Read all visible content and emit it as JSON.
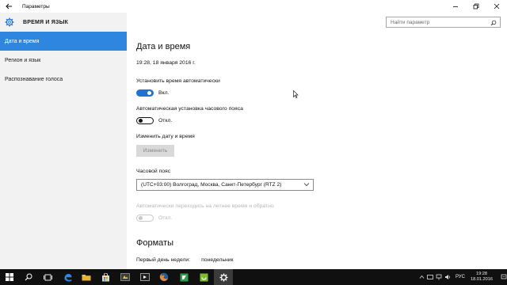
{
  "window": {
    "title": "Параметры",
    "controls": [
      "minimize",
      "maximize",
      "close"
    ]
  },
  "sidebar": {
    "title": "ВРЕМЯ И ЯЗЫК",
    "items": [
      {
        "label": "Дата и время",
        "active": true
      },
      {
        "label": "Регион и язык",
        "active": false
      },
      {
        "label": "Распознавание голоса",
        "active": false
      }
    ]
  },
  "search": {
    "placeholder": "Найти параметр"
  },
  "main": {
    "heading": "Дата и время",
    "current_datetime": "19:28, 18 января 2016 г.",
    "auto_time": {
      "label": "Установить время автоматически",
      "state": "Вкл.",
      "on": true
    },
    "auto_timezone": {
      "label": "Автоматическая установка часового пояса",
      "state": "Откл.",
      "on": false
    },
    "change_datetime": {
      "label": "Изменить дату и время",
      "button": "Изменить"
    },
    "timezone": {
      "label": "Часовой пояс",
      "value": "(UTC+03:00) Волгоград, Москва, Санкт-Петербург (RTZ 2)"
    },
    "dst": {
      "label": "Автоматически переходить на летнее время и обратно",
      "state": "Откл.",
      "enabled": false
    },
    "formats": {
      "heading": "Форматы",
      "first_day_label": "Первый день недели:",
      "first_day_value": "понедельник"
    }
  },
  "taskbar": {
    "items": [
      "start-icon",
      "search-icon",
      "task-view-icon",
      "edge-icon",
      "explorer-icon",
      "store-icon",
      "app-icon",
      "media-icon",
      "firefox-icon",
      "green-app-icon",
      "settings-app-icon",
      "gear-icon"
    ],
    "language": "РУС",
    "time": "19:28",
    "date": "18.01.2016"
  },
  "colors": {
    "accent": "#2e86de",
    "toggle_on": "#1e73d3",
    "sidebar_bg": "#f2f2f2",
    "taskbar_bg": "#101010"
  }
}
